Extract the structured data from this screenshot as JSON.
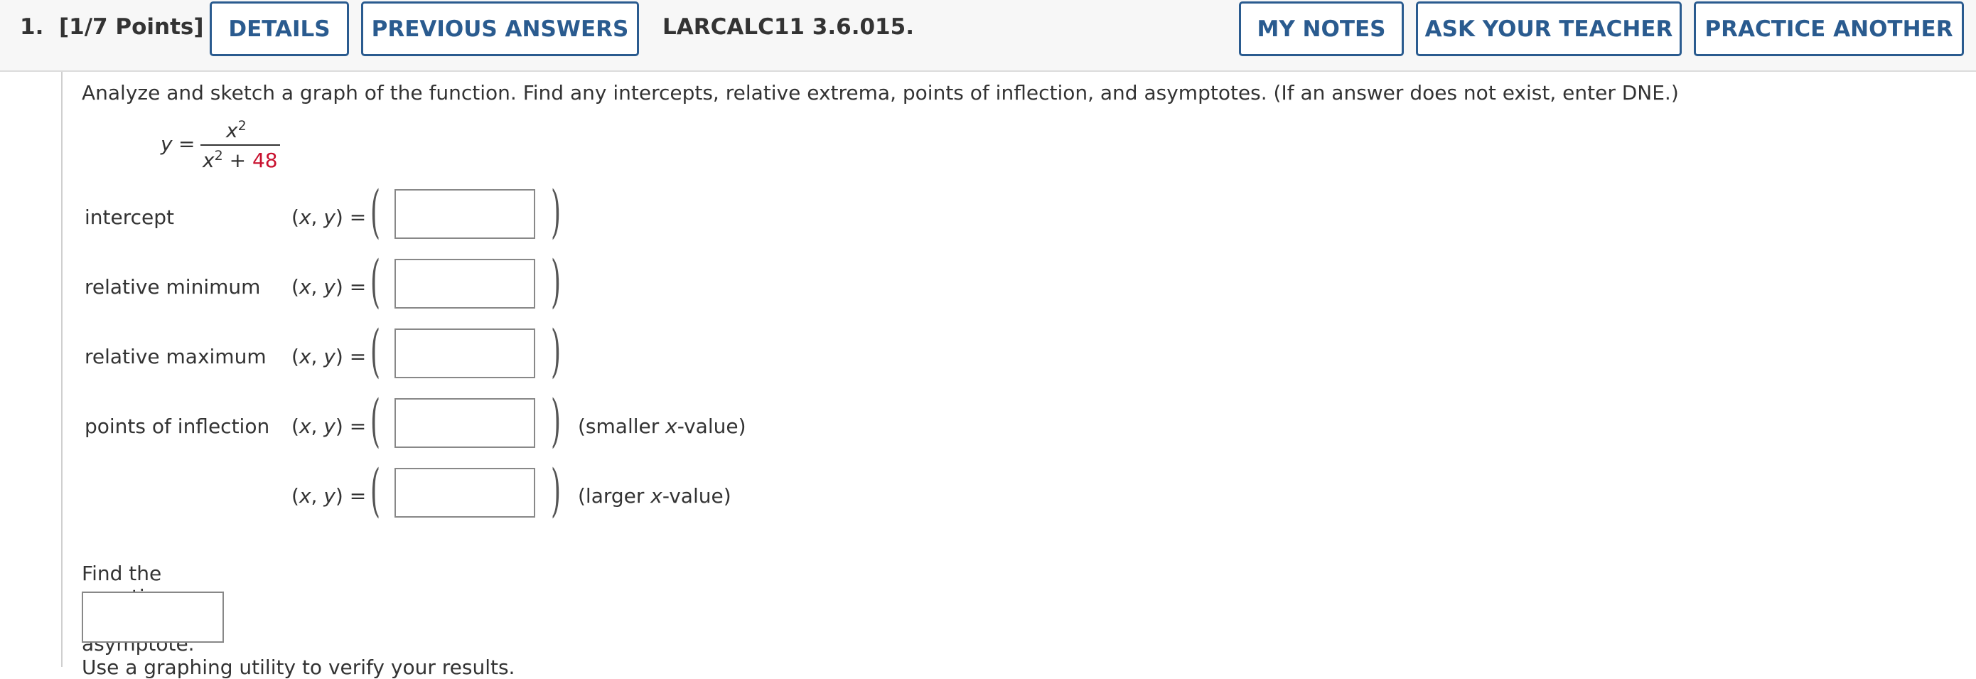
{
  "header": {
    "question_number": "1.",
    "points": "[1/7 Points]",
    "details_label": "DETAILS",
    "previous_answers_label": "PREVIOUS ANSWERS",
    "problem_code": "LARCALC11 3.6.015.",
    "my_notes_label": "MY NOTES",
    "ask_teacher_label": "ASK YOUR TEACHER",
    "practice_another_label": "PRACTICE ANOTHER"
  },
  "problem": {
    "prompt": "Analyze and sketch a graph of the function. Find any intercepts, relative extrema, points of inflection, and asymptotes. (If an answer does not exist, enter DNE.)",
    "function": {
      "lhs": "y",
      "equals": "=",
      "numerator_base": "x",
      "numerator_exp": "2",
      "denominator_base": "x",
      "denominator_exp": "2",
      "denominator_plus": " + ",
      "denominator_const": "48",
      "denominator_const_color": "#c8102e"
    }
  },
  "rows": [
    {
      "label": "intercept",
      "xy_label": "(x, y) =",
      "value": "",
      "note": ""
    },
    {
      "label": "relative minimum",
      "xy_label": "(x, y) =",
      "value": "",
      "note": ""
    },
    {
      "label": "relative maximum",
      "xy_label": "(x, y) =",
      "value": "",
      "note": ""
    },
    {
      "label": "points of inflection",
      "xy_label": "(x, y) =",
      "value": "",
      "note_prefix": "(smaller ",
      "note_var": "x",
      "note_suffix": "-value)"
    },
    {
      "label": "",
      "xy_label": "(x, y) =",
      "value": "",
      "note_prefix": "(larger ",
      "note_var": "x",
      "note_suffix": "-value)"
    }
  ],
  "asymptote": {
    "prompt": "Find the equation of the asymptote.",
    "value": ""
  },
  "footer_partial_text": "Use a graphing utility to verify your results."
}
